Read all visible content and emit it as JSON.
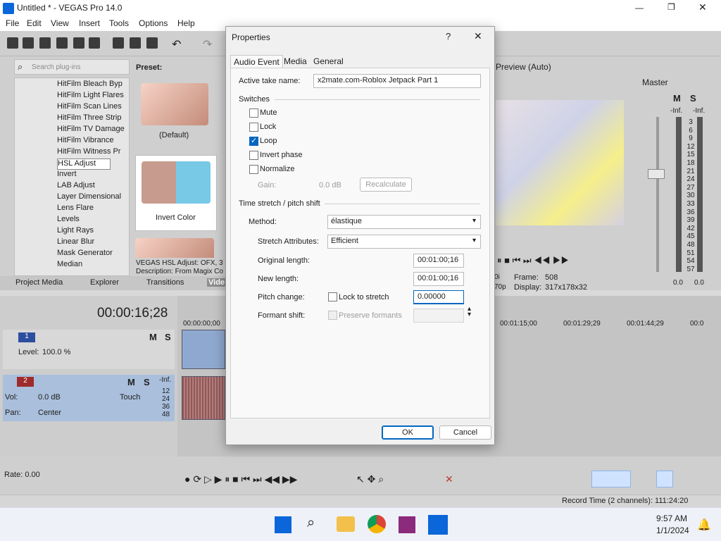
{
  "app": {
    "title": "Untitled * - VEGAS Pro 14.0"
  },
  "menu": [
    "File",
    "Edit",
    "View",
    "Insert",
    "Tools",
    "Options",
    "Help"
  ],
  "explorer": {
    "search_placeholder": "Search plug-ins",
    "preset_label": "Preset:",
    "plugins": [
      "HitFilm Bleach Byp",
      "HitFilm Light Flares",
      "HitFilm Scan Lines",
      "HitFilm Three Strip",
      "HitFilm TV Damage",
      "HitFilm Vibrance",
      "HitFilm Witness Pr",
      "HSL Adjust",
      "Invert",
      "LAB Adjust",
      "Layer Dimensional",
      "Lens Flare",
      "Levels",
      "Light Rays",
      "Linear Blur",
      "Mask Generator",
      "Median"
    ],
    "selected_plugin": "HSL Adjust",
    "preset_default": "(Default)",
    "preset_invert": "Invert Color",
    "plugin_info_1": "VEGAS HSL Adjust: OFX, 3",
    "plugin_info_2": "Description: From Magix Co",
    "tabs": [
      "Project Media",
      "Explorer",
      "Transitions",
      "Vide"
    ]
  },
  "preview": {
    "mode": "Preview (Auto)",
    "frame_label": "Frame:",
    "frame_value": "508",
    "display_label": "Display:",
    "display_value": "317x178x32",
    "left_partial_1": "0i",
    "left_partial_2": "70p"
  },
  "mixer": {
    "master": "Master",
    "m": "M",
    "s": "S",
    "inf_left": "-Inf.",
    "inf_right": "-Inf.",
    "scale": [
      "3",
      "6",
      "9",
      "12",
      "15",
      "18",
      "21",
      "24",
      "27",
      "30",
      "33",
      "36",
      "39",
      "42",
      "45",
      "48",
      "51",
      "54",
      "57"
    ],
    "db_left": "0.0",
    "db_right": "0.0"
  },
  "timeline": {
    "timecode": "00:00:16;28",
    "ruler": [
      "00:00:00;00",
      "00:01:15;00",
      "00:01:29;29",
      "00:01:44;29",
      "00:0"
    ],
    "track1": {
      "number": "1",
      "level_label": "Level:",
      "level_value": "100.0 %",
      "m": "M",
      "s": "S"
    },
    "track2": {
      "number": "2",
      "vol_label": "Vol:",
      "vol_value": "0.0 dB",
      "pan_label": "Pan:",
      "pan_value": "Center",
      "mode": "Touch",
      "inf": "-Inf.",
      "scale": [
        "12",
        "24",
        "36",
        "48"
      ],
      "m": "M",
      "s": "S"
    }
  },
  "transport": {
    "rate_label": "Rate: 0.00"
  },
  "status": {
    "record_time": "Record Time (2 channels): 111:24:20"
  },
  "taskbar": {
    "time": "9:57 AM",
    "date": "1/1/2024"
  },
  "dialog": {
    "title": "Properties",
    "help": "?",
    "close": "✕",
    "tabs": [
      "Audio Event",
      "Media",
      "General"
    ],
    "active_take_label": "Active take name:",
    "active_take_value": "x2mate.com-Roblox Jetpack Part 1",
    "switches_label": "Switches",
    "switches": [
      {
        "label": "Mute",
        "checked": false
      },
      {
        "label": "Lock",
        "checked": false
      },
      {
        "label": "Loop",
        "checked": true
      },
      {
        "label": "Invert phase",
        "checked": false
      },
      {
        "label": "Normalize",
        "checked": false
      }
    ],
    "gain_label": "Gain:",
    "gain_value": "0.0 dB",
    "recalculate": "Recalculate",
    "stretch_section": "Time stretch / pitch shift",
    "method_label": "Method:",
    "method_value": "élastique",
    "stretch_attr_label": "Stretch Attributes:",
    "stretch_attr_value": "Efficient",
    "original_length_label": "Original length:",
    "original_length_value": "00:01:00;16",
    "new_length_label": "New length:",
    "new_length_value": "00:01:00;16",
    "pitch_change_label": "Pitch change:",
    "lock_to_stretch_label": "Lock to stretch",
    "pitch_change_value": "0.00000",
    "formant_shift_label": "Formant shift:",
    "preserve_formants_label": "Preserve formants",
    "ok": "OK",
    "cancel": "Cancel"
  }
}
